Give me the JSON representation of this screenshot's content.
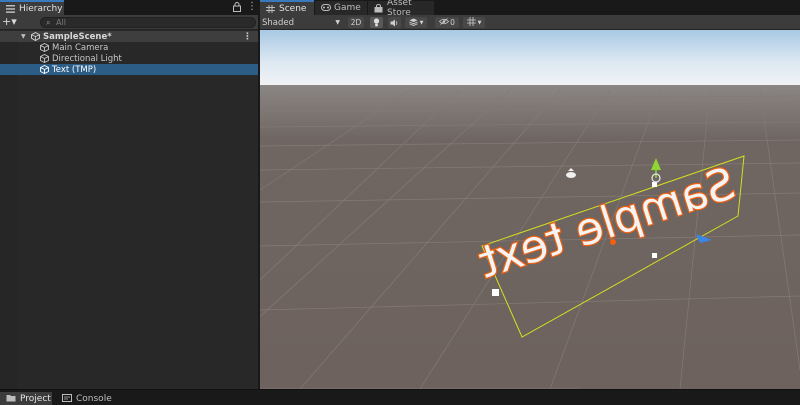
{
  "tabs": {
    "hierarchy": {
      "label": "Hierarchy",
      "icon": "list-icon"
    },
    "scene": {
      "label": "Scene",
      "icon": "grid-icon"
    },
    "game": {
      "label": "Game",
      "icon": "gamepad-icon"
    },
    "asset_store": {
      "label": "Asset Store",
      "icon": "bag-icon"
    }
  },
  "hierarchy": {
    "add_label": "+▾",
    "search_placeholder": "All",
    "scene_name": "SampleScene*",
    "items": [
      {
        "label": "Main Camera",
        "icon": "cube-icon"
      },
      {
        "label": "Directional Light",
        "icon": "cube-icon"
      },
      {
        "label": "Text (TMP)",
        "icon": "cube-icon",
        "selected": true
      }
    ]
  },
  "scene_toolbar": {
    "shading_mode": "Shaded",
    "mode_2d": "2D",
    "hidden_count": "0"
  },
  "viewport": {
    "text_object": "Sample text",
    "colors": {
      "sky_top": "#a8c8e4",
      "horizon": "#f2f4f6",
      "ground": "#6e6460",
      "grid": "#847a76",
      "selection_outline": "#d6de21",
      "text_outline": "#f06010",
      "gizmo_y": "#8fd632",
      "gizmo_z": "#3a86e8"
    }
  },
  "bottom_tabs": {
    "project": {
      "label": "Project",
      "icon": "folder-icon"
    },
    "console": {
      "label": "Console",
      "icon": "console-icon"
    }
  },
  "accent_color": "#3a79bb",
  "selection_color": "#2c5d87"
}
